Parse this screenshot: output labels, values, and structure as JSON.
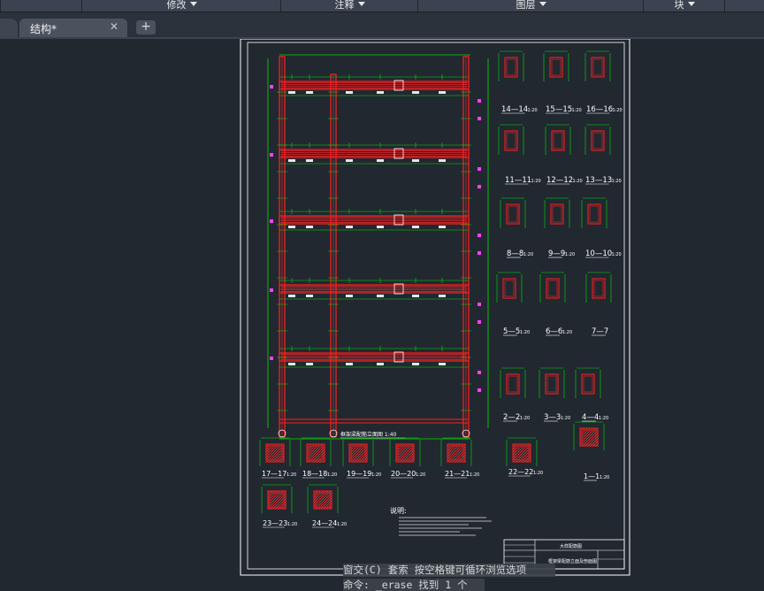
{
  "ribbon": {
    "panels": [
      {
        "label": ""
      },
      {
        "label": "修改"
      },
      {
        "label": "注释"
      },
      {
        "label": "图层"
      },
      {
        "label": "块"
      }
    ]
  },
  "tabs": {
    "active_label": "结构*",
    "close_glyph": "✕",
    "add_glyph": "+"
  },
  "drawing": {
    "elevation_caption": "框架梁配筋立面图 1:40",
    "sections": [
      {
        "label": "14—14",
        "scale": "1:20"
      },
      {
        "label": "15—15",
        "scale": "1:20"
      },
      {
        "label": "16—16",
        "scale": "1:20"
      },
      {
        "label": "11—11",
        "scale": "1:20"
      },
      {
        "label": "12—12",
        "scale": "1:20"
      },
      {
        "label": "13—13",
        "scale": "1:20"
      },
      {
        "label": "8—8",
        "scale": "1:20"
      },
      {
        "label": "9—9",
        "scale": "1:20"
      },
      {
        "label": "10—10",
        "scale": "1:20"
      },
      {
        "label": "5—5",
        "scale": "1:20"
      },
      {
        "label": "6—6",
        "scale": "1:20"
      },
      {
        "label": "7—7",
        "scale": ""
      },
      {
        "label": "2—2",
        "scale": "1:20"
      },
      {
        "label": "3—3",
        "scale": "1:20"
      },
      {
        "label": "4—4",
        "scale": "1:20"
      },
      {
        "label": "1—1",
        "scale": "1:20"
      },
      {
        "label": "17—17",
        "scale": "1:20"
      },
      {
        "label": "18—18",
        "scale": "1:20"
      },
      {
        "label": "19—19",
        "scale": "1:20"
      },
      {
        "label": "20—20",
        "scale": "1:20"
      },
      {
        "label": "21—21",
        "scale": "1:20"
      },
      {
        "label": "22—22",
        "scale": "1:20"
      },
      {
        "label": "23—23",
        "scale": "1:20"
      },
      {
        "label": "24—24",
        "scale": "1:20"
      }
    ],
    "notes_title": "说明:",
    "title_block": {
      "project": "大样配筋图",
      "drawing_name": "框架梁配筋立面及剖面图"
    }
  },
  "command": {
    "line1": "窗交(C) 套索  按空格键可循环浏览选项",
    "line2": "命令:  _erase 找到 1 个"
  },
  "colors": {
    "background": "#212830",
    "paper_border": "#ffffff",
    "rebar": "#ff1a1a",
    "dimension": "#00e000",
    "annotation": "#ff40ff"
  }
}
